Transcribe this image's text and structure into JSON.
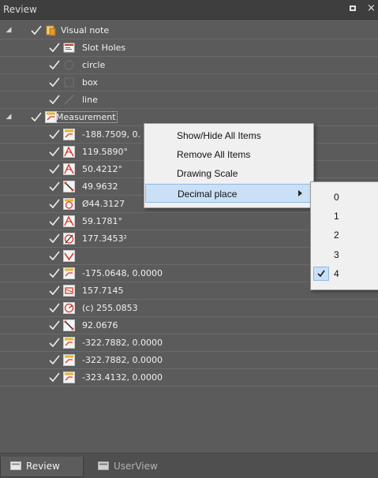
{
  "panel": {
    "title": "Review"
  },
  "tree": {
    "groups": [
      {
        "label": "Visual note",
        "children": [
          {
            "label": "Slot Holes"
          },
          {
            "label": "circle"
          },
          {
            "label": "box"
          },
          {
            "label": "line"
          }
        ]
      },
      {
        "label": "Measurement",
        "children": [
          {
            "label": "-188.7509, 0."
          },
          {
            "label": "119.5890°"
          },
          {
            "label": "50.4212°"
          },
          {
            "label": "49.9632"
          },
          {
            "label": "Ø44.3127"
          },
          {
            "label": "59.1781°"
          },
          {
            "label": "177.3453²"
          },
          {
            "label": ""
          },
          {
            "label": "-175.0648, 0.0000"
          },
          {
            "label": "157.7145"
          },
          {
            "label": "(c) 255.0853"
          },
          {
            "label": "92.0676"
          },
          {
            "label": "-322.7882, 0.0000"
          },
          {
            "label": "-322.7882, 0.0000"
          },
          {
            "label": "-323.4132, 0.0000"
          }
        ]
      }
    ]
  },
  "context_menu": {
    "items": [
      {
        "label": "Show/Hide All Items"
      },
      {
        "label": "Remove All Items"
      },
      {
        "label": "Drawing Scale"
      },
      {
        "label": "Decimal place"
      }
    ]
  },
  "submenu": {
    "items": [
      {
        "label": "0"
      },
      {
        "label": "1"
      },
      {
        "label": "2"
      },
      {
        "label": "3"
      },
      {
        "label": "4"
      }
    ],
    "checked_index": 4
  },
  "tabs": [
    {
      "label": "Review"
    },
    {
      "label": "UserView"
    }
  ],
  "colors": {
    "panel_bg": "#5b5b5b",
    "highlight": "#c9e0f7",
    "icon_red": "#d63a2a",
    "icon_yellow": "#e6b52e"
  }
}
